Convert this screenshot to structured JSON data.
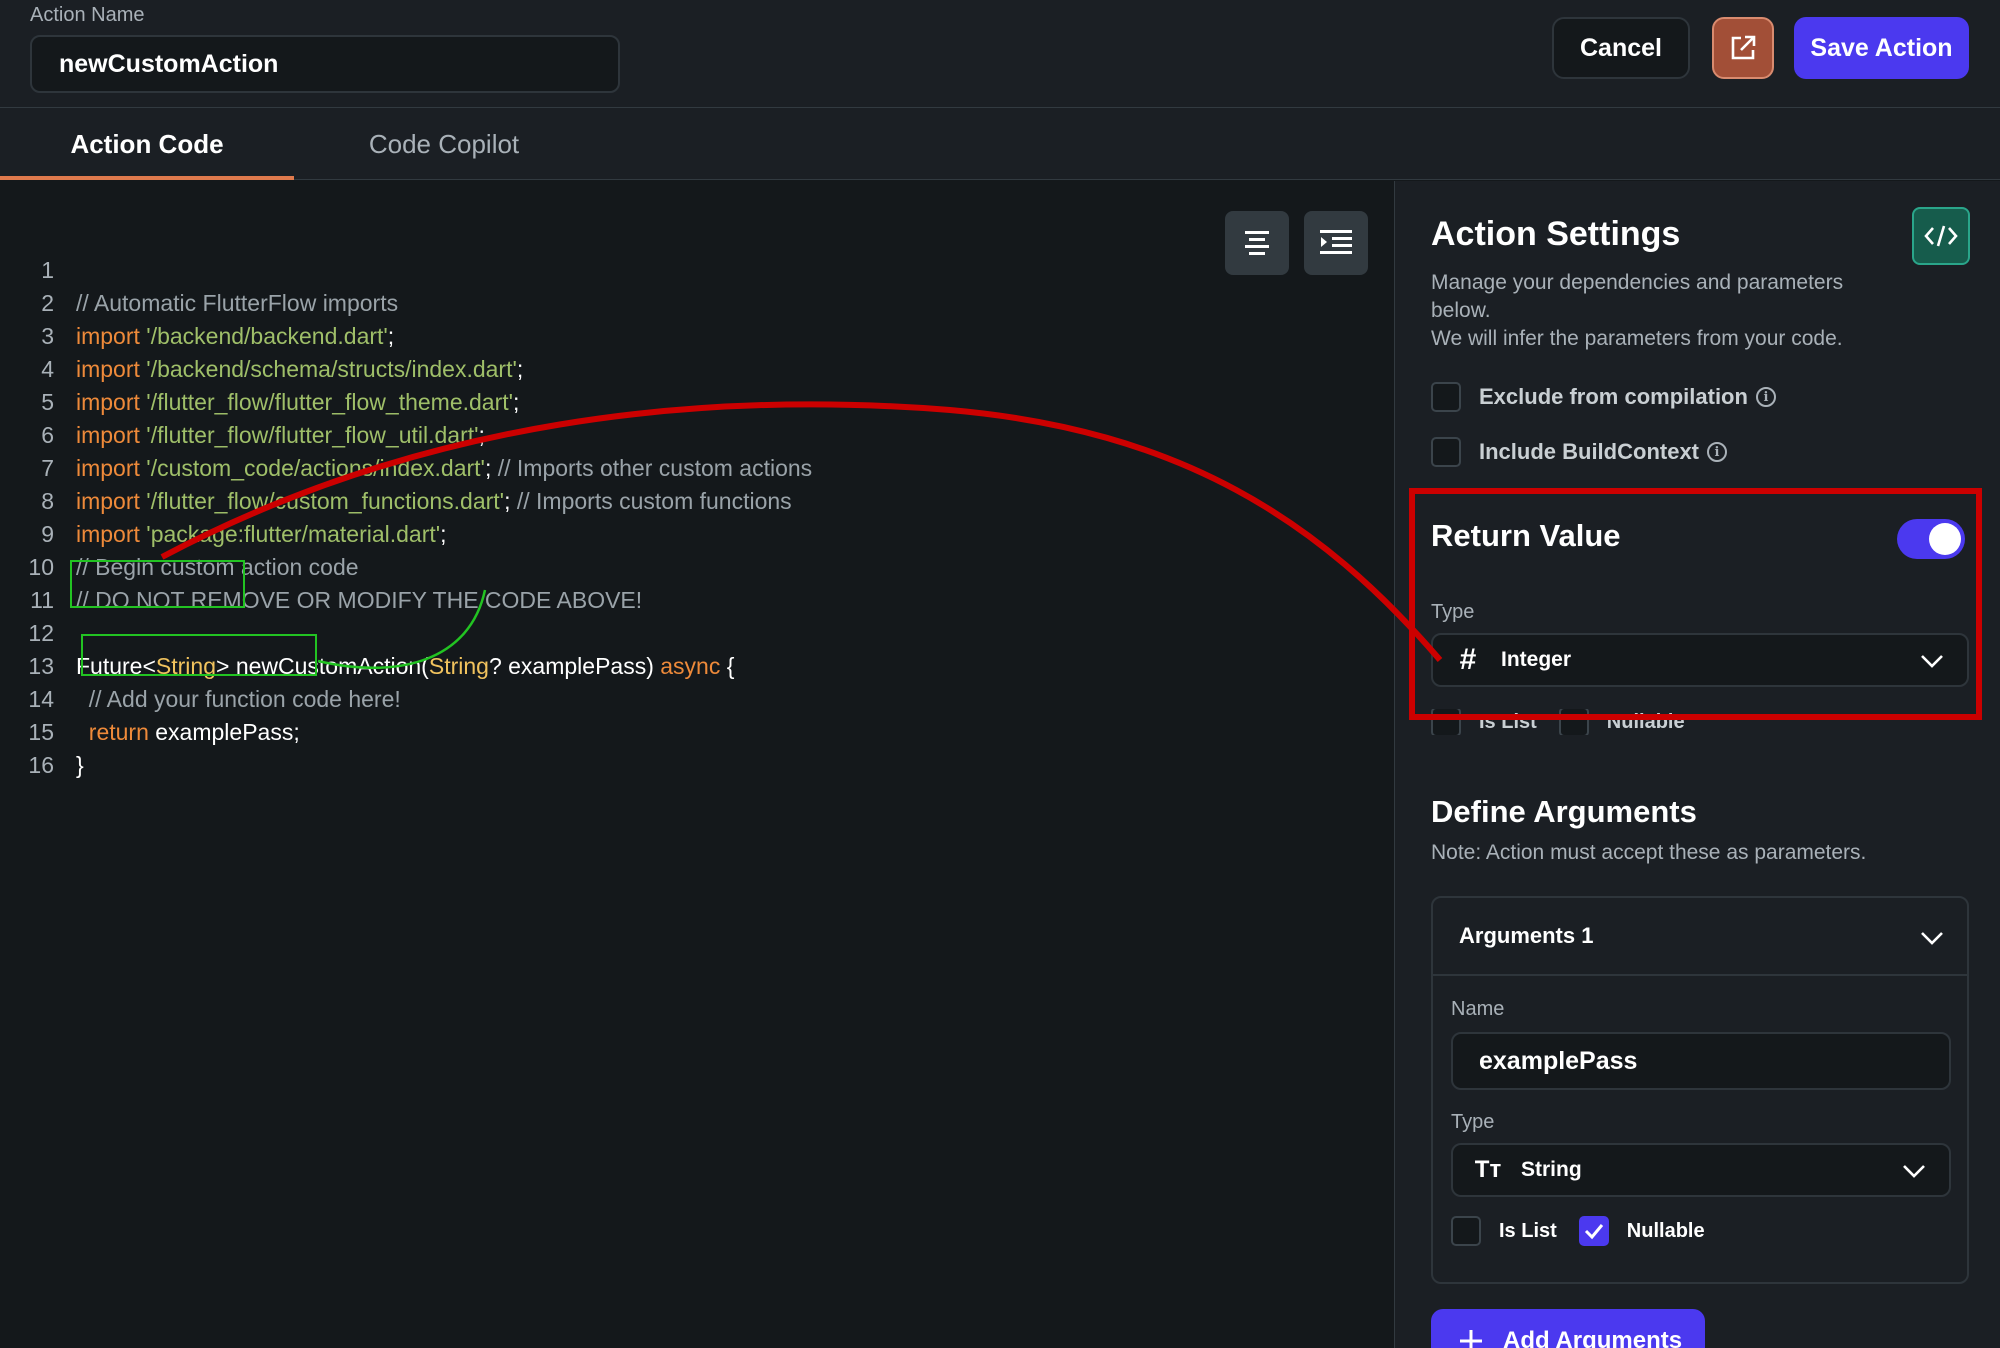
{
  "header": {
    "action_name_label": "Action Name",
    "action_name_value": "newCustomAction",
    "cancel_label": "Cancel",
    "save_label": "Save Action",
    "external_icon": "external-link-icon"
  },
  "tabs": [
    {
      "label": "Action Code",
      "active": true
    },
    {
      "label": "Code Copilot",
      "active": false
    }
  ],
  "editor": {
    "line_numbers": [
      "1",
      "2",
      "3",
      "4",
      "5",
      "6",
      "7",
      "8",
      "9",
      "10",
      "11",
      "12",
      "13",
      "14",
      "15",
      "16"
    ],
    "tools": [
      "align-center-icon",
      "indent-icon"
    ]
  },
  "code": {
    "l1": {
      "comment": "// Automatic FlutterFlow imports"
    },
    "l2": {
      "kw": "import",
      "str": "'/backend/backend.dart'",
      "end": ";"
    },
    "l3": {
      "kw": "import",
      "str": "'/backend/schema/structs/index.dart'",
      "end": ";"
    },
    "l4": {
      "kw": "import",
      "str": "'/flutter_flow/flutter_flow_theme.dart'",
      "end": ";"
    },
    "l5": {
      "kw": "import",
      "str": "'/flutter_flow/flutter_flow_util.dart'",
      "end": ";"
    },
    "l6": {
      "kw": "import",
      "str": "'/custom_code/actions/index.dart'",
      "end": ";",
      "comment": " // Imports other custom actions"
    },
    "l7": {
      "kw": "import",
      "str": "'/flutter_flow/custom_functions.dart'",
      "end": ";",
      "comment": " // Imports custom functions"
    },
    "l8": {
      "kw": "import",
      "str": "'package:flutter/material.dart'",
      "end": ";"
    },
    "l9": {
      "comment": "// Begin custom action code"
    },
    "l10": {
      "comment": "// DO NOT REMOVE OR MODIFY THE CODE ABOVE!"
    },
    "l12": {
      "future": "Future<",
      "ret_type": "String",
      "gt": ">",
      "fn": " newCustomAction(",
      "param_type": "String",
      "param": "? examplePass) ",
      "async": "async",
      "brace": " {"
    },
    "l13": {
      "comment": "  // Add your function code here!"
    },
    "l14": {
      "kw": "  return",
      "value": " examplePass;"
    },
    "l15": {
      "brace": "}"
    }
  },
  "settings": {
    "title": "Action Settings",
    "description_1": "Manage your dependencies and parameters below.",
    "description_2": "We will infer the parameters from your code.",
    "exclude_label": "Exclude from compilation",
    "include_ctx_label": "Include BuildContext",
    "return_value": {
      "title": "Return Value",
      "enabled": true,
      "type_label": "Type",
      "type_value": "Integer",
      "type_icon": "#",
      "is_list_label": "Is List",
      "nullable_label": "Nullable"
    },
    "define_args": {
      "title": "Define Arguments",
      "note": "Note: Action must accept these as parameters."
    },
    "argument": {
      "header": "Arguments 1",
      "name_label": "Name",
      "name_value": "examplePass",
      "type_label": "Type",
      "type_value": "String",
      "type_icon": "Tт",
      "is_list_label": "Is List",
      "is_list_checked": false,
      "nullable_label": "Nullable",
      "nullable_checked": true
    },
    "add_arguments_label": "Add Arguments"
  },
  "colors": {
    "accent": "#4b39ef",
    "annotation_red": "#cc0000",
    "annotation_green": "#22c322",
    "keyword": "#ee8a3a",
    "string": "#9fbf69",
    "type": "#f1c35e"
  }
}
